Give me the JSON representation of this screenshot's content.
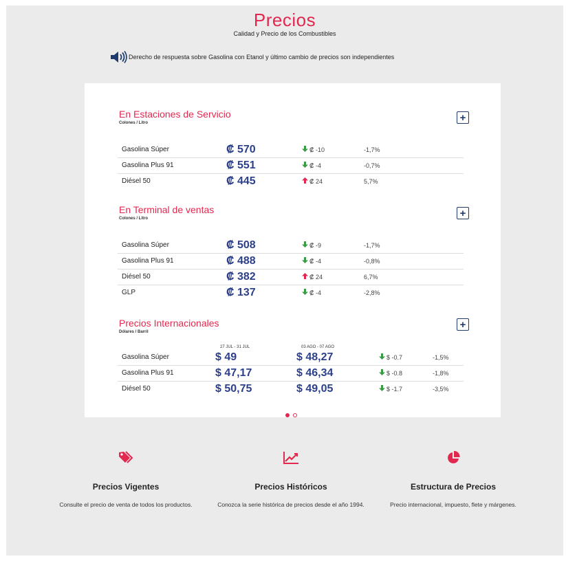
{
  "header": {
    "title": "Precios",
    "subtitle": "Calidad y Precio de los Combustibles",
    "notice": "Derecho de respuesta sobre Gasolina con Etanol y último cambio de precios son independientes"
  },
  "sections": [
    {
      "title": "En Estaciones de Servicio",
      "unit": "Colones / Litro",
      "rows": [
        {
          "name": "Gasolina Súper",
          "price": "₡ 570",
          "delta": "₡ -10",
          "direction": "down",
          "pct": "-1,7%"
        },
        {
          "name": "Gasolina Plus 91",
          "price": "₡ 551",
          "delta": "₡ -4",
          "direction": "down",
          "pct": "-0,7%"
        },
        {
          "name": "Diésel 50",
          "price": "₡ 445",
          "delta": "₡ 24",
          "direction": "up",
          "pct": "5,7%"
        }
      ]
    },
    {
      "title": "En Terminal de ventas",
      "unit": "Colones / Litro",
      "rows": [
        {
          "name": "Gasolina Súper",
          "price": "₡ 508",
          "delta": "₡ -9",
          "direction": "down",
          "pct": "-1,7%"
        },
        {
          "name": "Gasolina Plus 91",
          "price": "₡ 488",
          "delta": "₡ -4",
          "direction": "down",
          "pct": "-0,8%"
        },
        {
          "name": "Diésel 50",
          "price": "₡ 382",
          "delta": "₡ 24",
          "direction": "up",
          "pct": "6,7%"
        },
        {
          "name": "GLP",
          "price": "₡ 137",
          "delta": "₡ -4",
          "direction": "down",
          "pct": "-2,8%"
        }
      ]
    },
    {
      "title": "Precios Internacionales",
      "unit": "Dólares / Barril",
      "period1": "27 JUL - 31 JUL",
      "period2": "03 AGO - 07 AGO",
      "rows": [
        {
          "name": "Gasolina Súper",
          "price1": "$ 49",
          "price2": "$ 48,27",
          "delta": "$ -0.7",
          "direction": "down",
          "pct": "-1,5%"
        },
        {
          "name": "Gasolina Plus 91",
          "price1": "$ 47,17",
          "price2": "$ 46,34",
          "delta": "$ -0.8",
          "direction": "down",
          "pct": "-1,8%"
        },
        {
          "name": "Diésel 50",
          "price1": "$ 50,75",
          "price2": "$ 49,05",
          "delta": "$ -1.7",
          "direction": "down",
          "pct": "-3,5%"
        }
      ]
    }
  ],
  "expand_symbol": "+",
  "carousel": {
    "pages": 2,
    "active": 1
  },
  "features": [
    {
      "icon": "tags-icon",
      "title": "Precios Vigentes",
      "description": "Consulte el precio de venta de todos los productos."
    },
    {
      "icon": "line-chart-icon",
      "title": "Precios Históricos",
      "description": "Conozca la serie histórica de precios desde el año 1994."
    },
    {
      "icon": "pie-chart-icon",
      "title": "Estructura de Precios",
      "description": "Precio internacional, impuesto, flete y márgenes."
    }
  ],
  "colors": {
    "accent": "#e3284f",
    "price": "#2b3f8a",
    "down": "#3a9b47",
    "up": "#e3284f",
    "button": "#1f3b6e"
  }
}
